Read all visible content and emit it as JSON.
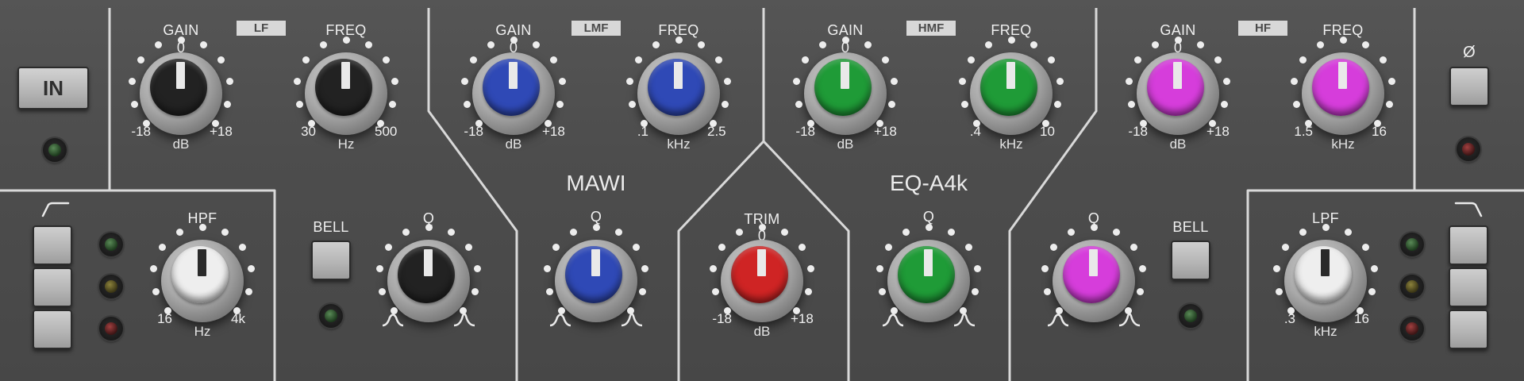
{
  "plugin": {
    "brand": "MAWI",
    "model": "EQ-A4k"
  },
  "colors": {
    "black": "#222222",
    "white": "#eeeeee",
    "blue": "#2f49b6",
    "green": "#1f9b37",
    "magenta": "#d63ddb",
    "red": "#cf2424"
  },
  "in_button": {
    "label": "IN"
  },
  "phase_button": {
    "label": "Ø"
  },
  "bands": {
    "lf": {
      "name": "LF",
      "gain": {
        "label": "GAIN",
        "center": "0",
        "min": "-18",
        "max": "+18",
        "unit": "dB",
        "value_db": 0
      },
      "freq": {
        "label": "FREQ",
        "min": "30",
        "max": "500",
        "unit": "Hz",
        "position": 0.5
      }
    },
    "lmf": {
      "name": "LMF",
      "gain": {
        "label": "GAIN",
        "center": "0",
        "min": "-18",
        "max": "+18",
        "unit": "dB",
        "value_db": 0
      },
      "freq": {
        "label": "FREQ",
        "min": ".1",
        "max": "2.5",
        "unit": "kHz",
        "position": 0.5
      },
      "q": {
        "label": "Q",
        "position": 0.5
      }
    },
    "hmf": {
      "name": "HMF",
      "gain": {
        "label": "GAIN",
        "center": "0",
        "min": "-18",
        "max": "+18",
        "unit": "dB",
        "value_db": 0
      },
      "freq": {
        "label": "FREQ",
        "min": ".4",
        "max": "10",
        "unit": "kHz",
        "position": 0.5
      },
      "q": {
        "label": "Q",
        "position": 0.5
      }
    },
    "hf": {
      "name": "HF",
      "gain": {
        "label": "GAIN",
        "center": "0",
        "min": "-18",
        "max": "+18",
        "unit": "dB",
        "value_db": 0
      },
      "freq": {
        "label": "FREQ",
        "min": "1.5",
        "max": "16",
        "unit": "kHz",
        "position": 0.5
      }
    }
  },
  "lf_bell": {
    "button_label": "BELL",
    "q_label": "Q",
    "q_position": 0.5
  },
  "hf_bell": {
    "button_label": "BELL",
    "q_label": "Q",
    "q_position": 0.5
  },
  "hpf": {
    "label": "HPF",
    "min": "16",
    "max": "4k",
    "unit": "Hz",
    "position": 0.5
  },
  "lpf": {
    "label": "LPF",
    "min": ".3",
    "max": "16",
    "unit": "kHz",
    "position": 0.5
  },
  "trim": {
    "label": "TRIM",
    "center": "0",
    "min": "-18",
    "max": "+18",
    "unit": "dB",
    "value_db": 0
  },
  "icons": {
    "hpf_slope": "hpf-slope-icon",
    "lpf_slope": "lpf-slope-icon",
    "q_wide": "q-wide-icon",
    "q_narrow": "q-narrow-icon"
  }
}
